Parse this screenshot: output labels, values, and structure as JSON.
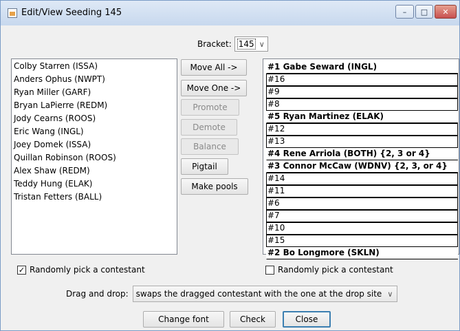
{
  "window": {
    "title": "Edit/View Seeding 145"
  },
  "window_controls": {
    "minimize": "–",
    "maximize": "□",
    "close": "✕"
  },
  "bracket": {
    "label": "Bracket:",
    "value": "145"
  },
  "unseeded": [
    "Colby Starren (ISSA)",
    "Anders Ophus (NWPT)",
    "Ryan Miller (GARF)",
    "Bryan LaPierre (REDM)",
    "Jody Cearns (ROOS)",
    "Eric Wang (INGL)",
    "Joey Domek (ISSA)",
    "Quillan Robinson (ROOS)",
    "Alex Shaw (REDM)",
    "Teddy Hung (ELAK)",
    "Tristan Fetters (BALL)"
  ],
  "buttons": {
    "move_all": "Move All ->",
    "move_one": "Move One ->",
    "promote": "Promote",
    "demote": "Demote",
    "balance": "Balance",
    "pigtail": "Pigtail",
    "make_pools": "Make pools",
    "change_font": "Change font",
    "check": "Check",
    "close": "Close"
  },
  "seeds": [
    "#1 Gabe Seward (INGL)",
    "#16",
    "#9",
    "#8",
    "#5 Ryan Martinez (ELAK)",
    "#12",
    "#13",
    "#4 Rene Arriola (BOTH) {2, 3 or 4}",
    "#3 Connor McCaw (WDNV) {2, 3, or 4}",
    "#14",
    "#11",
    "#6",
    "#7",
    "#10",
    "#15",
    "#2 Bo Longmore (SKLN)"
  ],
  "left_random": {
    "label": "Randomly pick a contestant",
    "checked": true
  },
  "right_random": {
    "label": "Randomly pick a contestant",
    "checked": false
  },
  "drag_drop": {
    "label": "Drag and drop:",
    "value": "swaps the dragged contestant with the one at the drop site"
  }
}
